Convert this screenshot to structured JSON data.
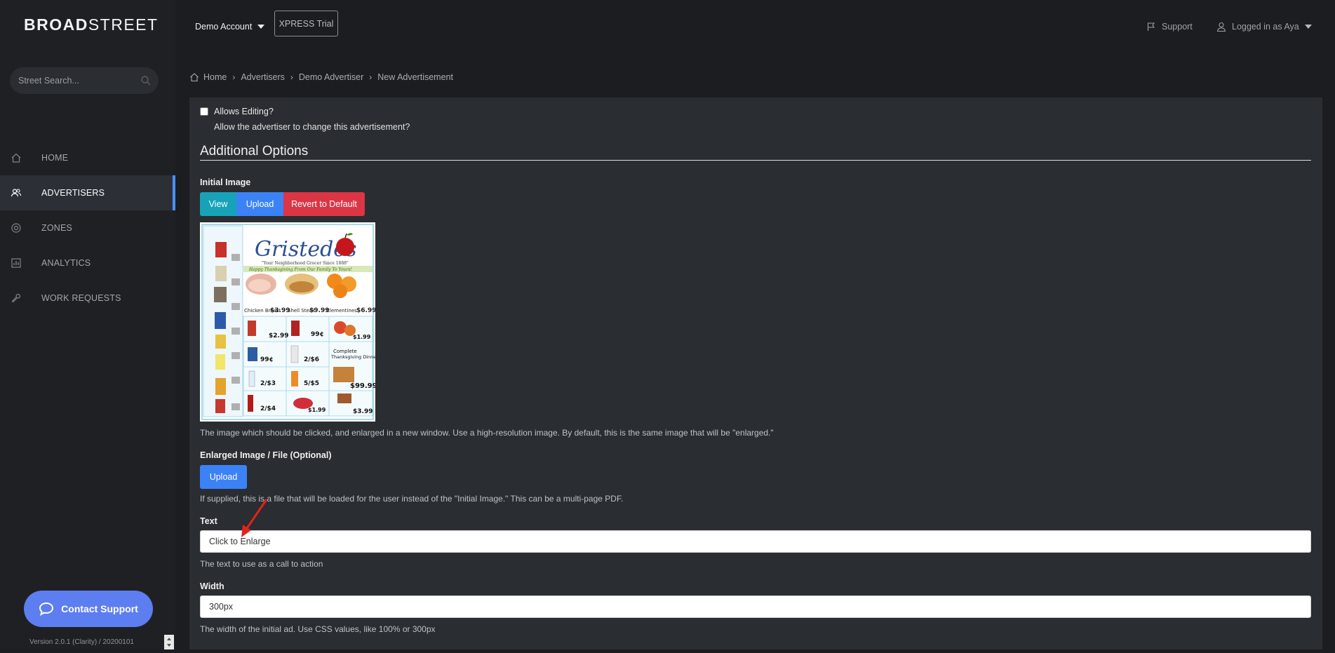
{
  "brand": {
    "bold": "BROAD",
    "light": "STREET"
  },
  "sidebar": {
    "search_placeholder": "Street Search...",
    "items": [
      {
        "label": "HOME",
        "icon": "home-icon",
        "active": false
      },
      {
        "label": "ADVERTISERS",
        "icon": "users-icon",
        "active": true
      },
      {
        "label": "ZONES",
        "icon": "target-icon",
        "active": false
      },
      {
        "label": "ANALYTICS",
        "icon": "chart-icon",
        "active": false
      },
      {
        "label": "WORK REQUESTS",
        "icon": "wrench-icon",
        "active": false
      }
    ],
    "contact_label": "Contact Support",
    "version": "Version 2.0.1 (Clarity) / 20200101"
  },
  "topbar": {
    "account": "Demo Account",
    "trial": "XPRESS Trial",
    "support": "Support",
    "user": "Logged in as Aya"
  },
  "breadcrumb": [
    "Home",
    "Advertisers",
    "Demo Advertiser",
    "New Advertisement"
  ],
  "form": {
    "allows_editing_label": "Allows Editing?",
    "allows_editing_help": "Allow the advertiser to change this advertisement?",
    "section_title": "Additional Options",
    "initial_image_label": "Initial Image",
    "view_btn": "View",
    "upload_btn": "Upload",
    "revert_btn": "Revert to Default",
    "initial_image_help": "The image which should be clicked, and enlarged in a new window. Use a high-resolution image. By default, this is the same image that will be \"enlarged.\"",
    "enlarged_label": "Enlarged Image / File (Optional)",
    "enlarged_upload_btn": "Upload",
    "enlarged_help": "If supplied, this is a file that will be loaded for the user instead of the \"Initial Image.\" This can be a multi-page PDF.",
    "text_label": "Text",
    "text_value": "Click to Enlarge",
    "text_help": "The text to use as a call to action",
    "width_label": "Width",
    "width_value": "300px",
    "width_help": "The width of the initial ad. Use CSS values, like 100% or 300px"
  },
  "ad": {
    "brand": "Gristedes",
    "tagline": "\"Your Neighborhood Grocer Since 1888\"",
    "banner": "Happy Thanksgiving From Our Family To Yours!",
    "items": [
      {
        "name": "Chicken Breast",
        "price": "$3.99"
      },
      {
        "name": "Shell Steak",
        "price": "$9.99"
      },
      {
        "name": "Clementines",
        "price": "$6.99"
      }
    ]
  },
  "colors": {
    "accent": "#4a8ff7",
    "view": "#17a2b8",
    "upload": "#3b82f6",
    "revert": "#dc3545",
    "contact": "#5d7ef0"
  }
}
